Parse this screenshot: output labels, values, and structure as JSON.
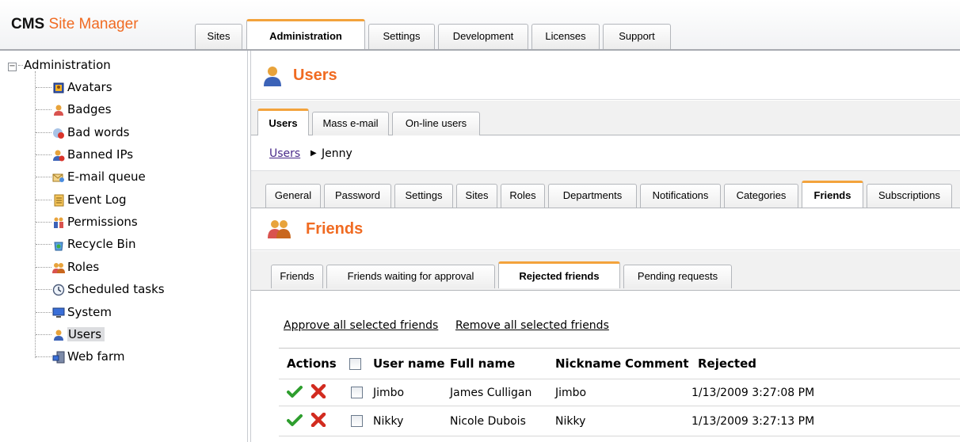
{
  "header": {
    "logo_cms": "CMS",
    "logo_sitemanager": "Site Manager",
    "tabs": [
      {
        "label": "Sites"
      },
      {
        "label": "Administration",
        "active": true
      },
      {
        "label": "Settings"
      },
      {
        "label": "Development"
      },
      {
        "label": "Licenses"
      },
      {
        "label": "Support"
      }
    ]
  },
  "sidebar": {
    "root": {
      "label": "Administration",
      "expander": "−"
    },
    "items": [
      {
        "label": "Avatars",
        "icon": "avatar-icon"
      },
      {
        "label": "Badges",
        "icon": "badge-icon"
      },
      {
        "label": "Bad words",
        "icon": "bad-words-icon"
      },
      {
        "label": "Banned IPs",
        "icon": "banned-ip-icon"
      },
      {
        "label": "E-mail queue",
        "icon": "email-queue-icon"
      },
      {
        "label": "Event Log",
        "icon": "event-log-icon"
      },
      {
        "label": "Permissions",
        "icon": "permissions-icon"
      },
      {
        "label": "Recycle Bin",
        "icon": "recycle-bin-icon"
      },
      {
        "label": "Roles",
        "icon": "roles-icon"
      },
      {
        "label": "Scheduled tasks",
        "icon": "clock-icon"
      },
      {
        "label": "System",
        "icon": "computer-icon"
      },
      {
        "label": "Users",
        "icon": "user-icon",
        "selected": true
      },
      {
        "label": "Web farm",
        "icon": "server-icon"
      }
    ]
  },
  "main": {
    "title": "Users",
    "tabs": [
      {
        "label": "Users",
        "active": true
      },
      {
        "label": "Mass e-mail"
      },
      {
        "label": "On-line users"
      }
    ],
    "breadcrumb": {
      "parent": "Users",
      "separator": "▶",
      "current": "Jenny"
    },
    "user_tabs": [
      {
        "label": "General"
      },
      {
        "label": "Password"
      },
      {
        "label": "Settings"
      },
      {
        "label": "Sites"
      },
      {
        "label": "Roles"
      },
      {
        "label": "Departments"
      },
      {
        "label": "Notifications"
      },
      {
        "label": "Categories"
      },
      {
        "label": "Friends",
        "active": true
      },
      {
        "label": "Subscriptions"
      }
    ],
    "friends_title": "Friends",
    "friends_tabs": [
      {
        "label": "Friends"
      },
      {
        "label": "Friends waiting for approval"
      },
      {
        "label": "Rejected friends",
        "active": true
      },
      {
        "label": "Pending requests"
      }
    ],
    "actions": {
      "approve_all": "Approve all selected friends",
      "remove_all": "Remove all selected friends"
    },
    "grid": {
      "columns": [
        "Actions",
        "User name",
        "Full name",
        "Nickname",
        "Comment",
        "Rejected"
      ],
      "rows": [
        {
          "username": "Jimbo",
          "fullname": "James Culligan",
          "nickname": "Jimbo",
          "comment": "",
          "rejected": "1/13/2009 3:27:08 PM"
        },
        {
          "username": "Nikky",
          "fullname": "Nicole Dubois",
          "nickname": "Nikky",
          "comment": "",
          "rejected": "1/13/2009 3:27:13 PM"
        }
      ]
    }
  },
  "colors": {
    "accent_orange": "#f06b22",
    "tab_highlight": "#f3a33c",
    "link_purple": "#4a2a8a",
    "approve_green": "#2e9e2e",
    "reject_red": "#d22b1f"
  }
}
